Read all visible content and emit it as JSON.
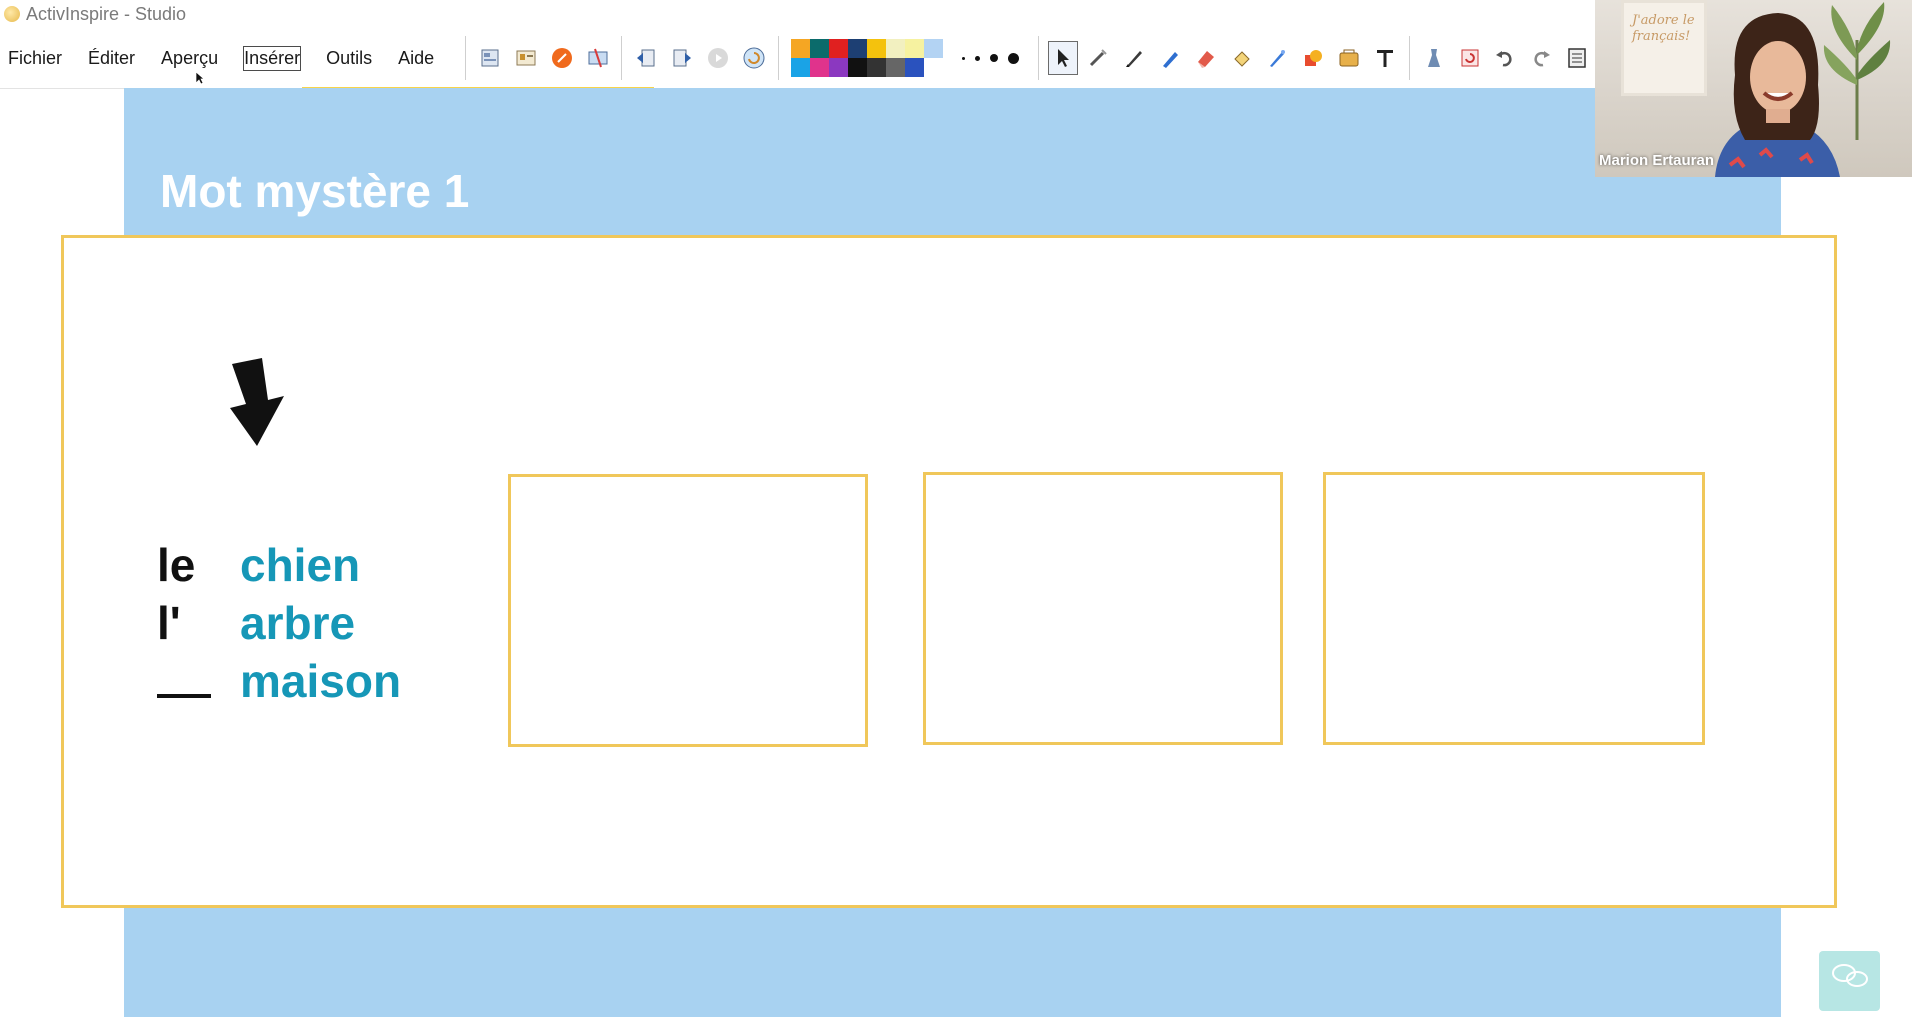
{
  "window": {
    "title": "ActivInspire - Studio"
  },
  "menu": [
    {
      "label": "Fichier",
      "active": false
    },
    {
      "label": "Éditer",
      "active": false
    },
    {
      "label": "Aperçu",
      "active": false
    },
    {
      "label": "Insérer",
      "active": true
    },
    {
      "label": "Outils",
      "active": false
    },
    {
      "label": "Aide",
      "active": false
    }
  ],
  "toolbar": {
    "left_tools": [
      "page-browser-icon",
      "resource-icon",
      "pen-orange-icon",
      "screen-tool-icon",
      "previous-page-icon",
      "next-page-icon",
      "play-icon",
      "reset-page-icon"
    ],
    "palette": [
      "#f5a623",
      "#0b6b6b",
      "#e02020",
      "#1d3f73",
      "#f4c20d",
      "#f2f0c0",
      "#f6f2a0",
      "#b3d3f3",
      "#1aa3e6",
      "#e0338c",
      "#8b38c0",
      "#111111",
      "#333333",
      "#666666",
      "#2a52be",
      "#ffffff"
    ],
    "pen_sizes": [
      "small",
      "medium",
      "large",
      "xlarge"
    ],
    "right_tools": [
      "select-icon",
      "magic-ink-icon",
      "pen-icon",
      "highlighter-icon",
      "eraser-icon",
      "fill-icon",
      "marker-icon",
      "shape-icon",
      "connector-icon",
      "text-icon",
      "tools-icon",
      "refresh-icon",
      "undo-icon",
      "redo-icon",
      "document-icon"
    ]
  },
  "slide": {
    "title": "Mot mystère 1",
    "articles": [
      "le",
      "l'"
    ],
    "nouns": [
      "chien",
      "arbre",
      "maison"
    ],
    "answer_box_count": 3
  },
  "webcam": {
    "participant_name": "Marion Ertauran",
    "wall_art_text": "J'adore le français!"
  },
  "colors": {
    "slide_background": "#a8d2f1",
    "card_border": "#f0c75a",
    "noun_color": "#1697b7"
  }
}
